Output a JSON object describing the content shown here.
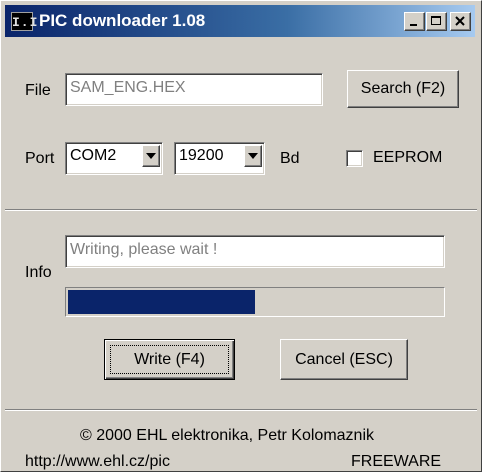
{
  "window": {
    "title": "PIC downloader 1.08",
    "app_icon_text": "I.I"
  },
  "file": {
    "label": "File",
    "value": "SAM_ENG.HEX",
    "search_button": "Search (F2)"
  },
  "port": {
    "label": "Port",
    "port_value": "COM2",
    "baud_value": "19200",
    "baud_unit": "Bd",
    "eeprom_label": "EEPROM",
    "eeprom_checked": false
  },
  "info": {
    "label": "Info",
    "value": "Writing, please wait !",
    "progress_fraction": 0.5
  },
  "actions": {
    "write_button": "Write (F4)",
    "cancel_button": "Cancel (ESC)"
  },
  "footer": {
    "copyright": "© 2000 EHL elektronika, Petr Kolomaznik",
    "url": "http://www.ehl.cz/pic",
    "license": "FREEWARE"
  },
  "colors": {
    "titlebar": "#0a246a",
    "progress": "#0a246a",
    "face": "#d4d0c8"
  }
}
